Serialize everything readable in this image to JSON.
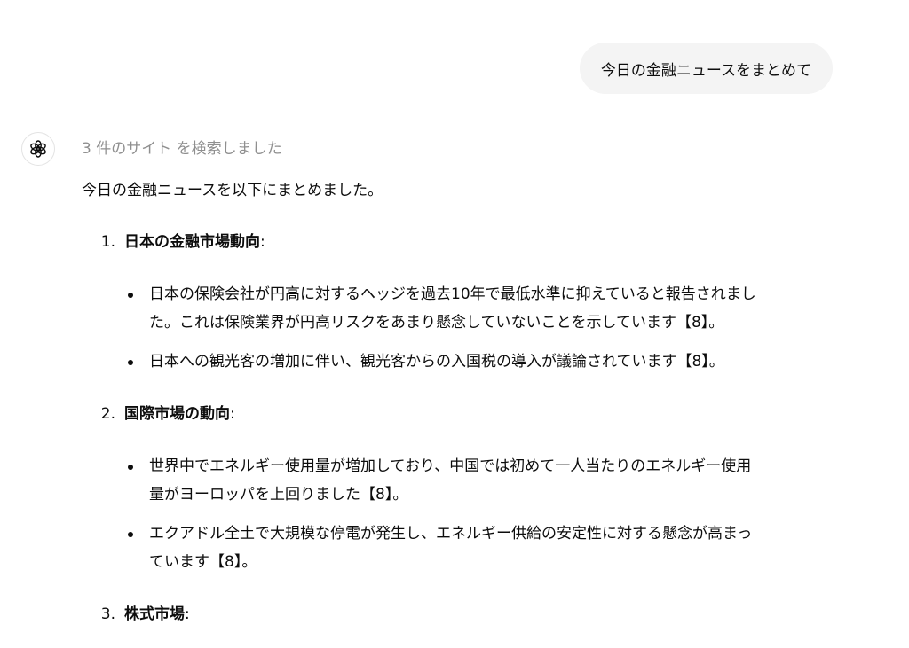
{
  "user_message": "今日の金融ニュースをまとめて",
  "assistant": {
    "search_status": "3 件のサイト を検索しました",
    "intro": "今日の金融ニュースを以下にまとめました。",
    "sections": [
      {
        "number": "1.",
        "title": "日本の金融市場動向",
        "suffix": ":",
        "bullets": [
          {
            "line1": "日本の保険会社が円高に対するヘッジを過去10年で最低水準に抑えていると報告されまし",
            "line2": "た。これは保険業界が円高リスクをあまり懸念していないことを示しています【8】。"
          },
          {
            "line1": "日本への観光客の増加に伴い、観光客からの入国税の導入が議論されています【8】。"
          }
        ]
      },
      {
        "number": "2.",
        "title": "国際市場の動向",
        "suffix": ":",
        "bullets": [
          {
            "line1": "世界中でエネルギー使用量が増加しており、中国では初めて一人当たりのエネルギー使用",
            "line2": "量がヨーロッパを上回りました【8】。"
          },
          {
            "line1": "エクアドル全土で大規模な停電が発生し、エネルギー供給の安定性に対する懸念が高まっ",
            "line2": "ています【8】。"
          }
        ]
      },
      {
        "number": "3.",
        "title": "株式市場",
        "suffix": ":"
      }
    ]
  },
  "icons": {
    "assistant_avatar": "openai-logo-icon"
  }
}
